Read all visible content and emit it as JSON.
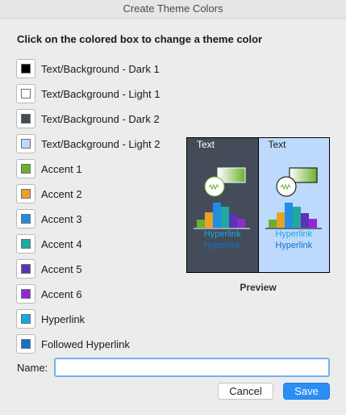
{
  "window": {
    "title": "Create Theme Colors"
  },
  "instruction": "Click on the colored box to change a theme color",
  "theme_colors": [
    {
      "label": "Text/Background - Dark 1",
      "color": "#000000"
    },
    {
      "label": "Text/Background - Light 1",
      "color": "#ffffff"
    },
    {
      "label": "Text/Background - Dark 2",
      "color": "#444c59"
    },
    {
      "label": "Text/Background - Light 2",
      "color": "#bdd9fb"
    },
    {
      "label": "Accent 1",
      "color": "#6ab12b"
    },
    {
      "label": "Accent 2",
      "color": "#e9a128"
    },
    {
      "label": "Accent 3",
      "color": "#1f8fe3"
    },
    {
      "label": "Accent 4",
      "color": "#20a99f"
    },
    {
      "label": "Accent 5",
      "color": "#5b33b3"
    },
    {
      "label": "Accent 6",
      "color": "#9129d8"
    },
    {
      "label": "Hyperlink",
      "color": "#15a9e5"
    },
    {
      "label": "Followed Hyperlink",
      "color": "#1471c6"
    }
  ],
  "preview": {
    "label": "Preview",
    "text": "Text",
    "hyperlink": "Hyperlink",
    "followed_hyperlink": "Hyperlink"
  },
  "name_field": {
    "label": "Name:",
    "value": ""
  },
  "buttons": {
    "cancel": "Cancel",
    "save": "Save"
  }
}
